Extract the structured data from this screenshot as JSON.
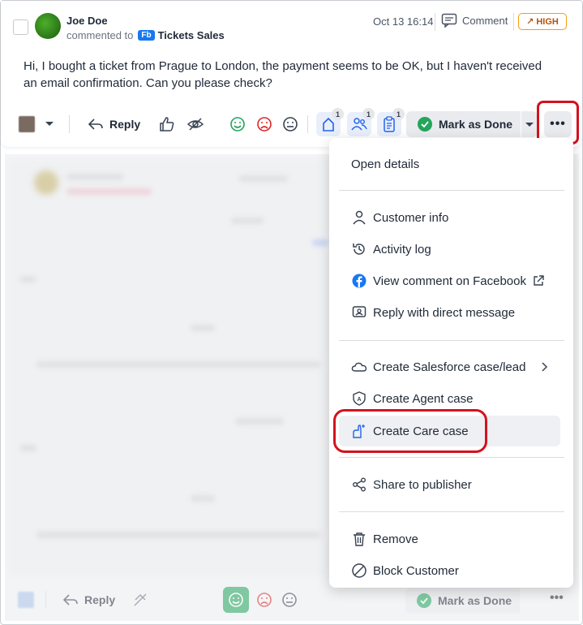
{
  "post": {
    "author": "Joe Doe",
    "action_text": "commented to",
    "channel_badge": "Fb",
    "channel_name": "Tickets Sales",
    "date": "Oct 13 16:14",
    "comment_label": "Comment",
    "priority_label": "HIGH",
    "message": "Hi, I bought a ticket from Prague to London, the payment seems to be OK, but I haven't received an email confirmation. Can you please check?"
  },
  "toolbar": {
    "reply_label": "Reply",
    "counters": [
      {
        "icon": "care-case-icon",
        "count": "1"
      },
      {
        "icon": "people-icon",
        "count": "1"
      },
      {
        "icon": "clipboard-icon",
        "count": "1"
      }
    ],
    "mark_done_label": "Mark as Done",
    "more_label": "•••"
  },
  "menu": {
    "items": [
      {
        "label": "Open details",
        "icon": ""
      },
      {
        "label": "Customer info",
        "icon": "person-icon"
      },
      {
        "label": "Activity log",
        "icon": "history-icon"
      },
      {
        "label": "View comment on Facebook",
        "icon": "facebook-icon"
      },
      {
        "label": "Reply with direct message",
        "icon": "direct-message-icon"
      },
      {
        "label": "Create Salesforce case/lead",
        "icon": "salesforce-cloud-icon"
      },
      {
        "label": "Create Agent case",
        "icon": "agent-shield-icon"
      },
      {
        "label": "Create Care case",
        "icon": "care-case-icon"
      },
      {
        "label": "Share to publisher",
        "icon": "share-icon"
      },
      {
        "label": "Remove",
        "icon": "trash-icon"
      },
      {
        "label": "Block Customer",
        "icon": "block-icon"
      }
    ]
  },
  "bottom": {
    "reply_label": "Reply",
    "mark_done_label": "Mark as Done"
  },
  "colors": {
    "highlight": "#d4121e",
    "priority": "#f59e0b",
    "facebook": "#1877f2",
    "done": "#22a55c"
  }
}
